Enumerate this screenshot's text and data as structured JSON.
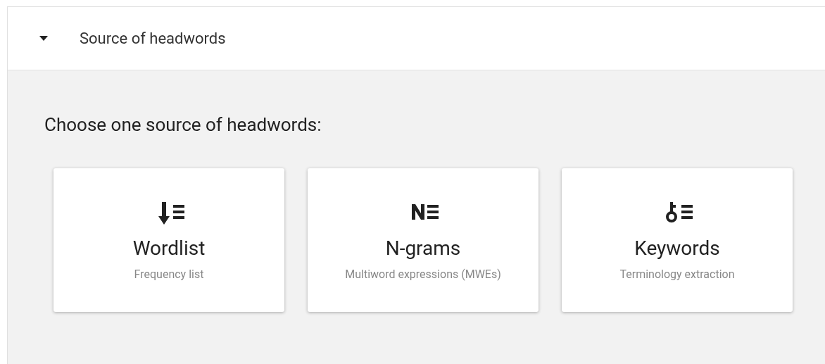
{
  "section": {
    "title": "Source of headwords",
    "expanded": true
  },
  "prompt": "Choose one source of headwords:",
  "sources": [
    {
      "kind": "wordlist",
      "title": "Wordlist",
      "subtitle": "Frequency list"
    },
    {
      "kind": "ngrams",
      "title": "N-grams",
      "subtitle": "Multiword expressions (MWEs)"
    },
    {
      "kind": "keywords",
      "title": "Keywords",
      "subtitle": "Terminology extraction"
    }
  ]
}
